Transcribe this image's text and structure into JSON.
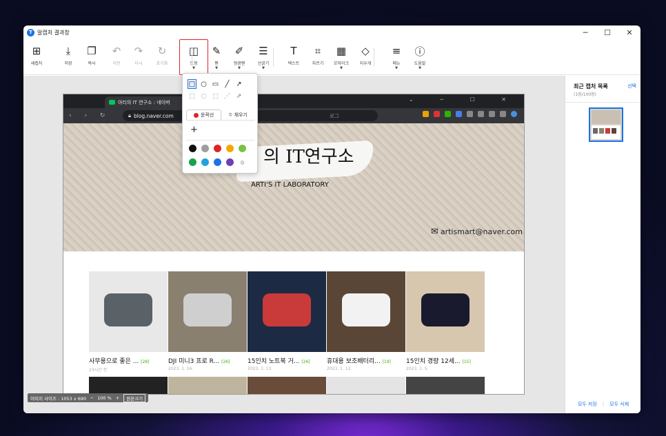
{
  "window": {
    "title": "알캡처 결과창",
    "logo": "T",
    "controls": [
      "─",
      "☐",
      "✕"
    ]
  },
  "toolbar": {
    "items": [
      {
        "key": "new",
        "label": "새캡처",
        "icon": "new-capture-icon",
        "glyph": "⊞"
      },
      {
        "key": "save",
        "label": "저장",
        "icon": "download-icon",
        "glyph": "⤓"
      },
      {
        "key": "copy",
        "label": "복사",
        "icon": "copy-icon",
        "glyph": "❐"
      },
      {
        "key": "undo",
        "label": "이전",
        "icon": "undo-icon",
        "glyph": "↶",
        "disabled": true
      },
      {
        "key": "redo",
        "label": "다시",
        "icon": "redo-icon",
        "glyph": "↷",
        "disabled": true
      },
      {
        "key": "reset",
        "label": "초기화",
        "icon": "reset-icon",
        "glyph": "↻",
        "disabled": true
      },
      {
        "key": "shape",
        "label": "도형",
        "icon": "shape-icon",
        "glyph": "◫",
        "caret": true
      },
      {
        "key": "pen",
        "label": "펜",
        "icon": "pen-icon",
        "glyph": "✎",
        "caret": true
      },
      {
        "key": "highlighter",
        "label": "형광펜",
        "icon": "highlighter-icon",
        "glyph": "✐",
        "caret": true
      },
      {
        "key": "thickness",
        "label": "선굵기",
        "icon": "line-width-icon",
        "glyph": "☰",
        "caret": true
      },
      {
        "key": "text",
        "label": "텍스트",
        "icon": "text-icon",
        "glyph": "T"
      },
      {
        "key": "crop",
        "label": "자르기",
        "icon": "crop-icon",
        "glyph": "⌗"
      },
      {
        "key": "mosaic",
        "label": "모자이크",
        "icon": "mosaic-icon",
        "glyph": "▦",
        "caret": true
      },
      {
        "key": "eraser",
        "label": "지우개",
        "icon": "eraser-icon",
        "glyph": "◇"
      },
      {
        "key": "menu",
        "label": "메뉴",
        "icon": "menu-icon",
        "glyph": "≡",
        "caret": true
      },
      {
        "key": "help",
        "label": "도움말",
        "icon": "help-icon",
        "glyph": "ⓘ",
        "caret": true
      }
    ]
  },
  "shape_popup": {
    "row1": [
      "□",
      "○",
      "▭",
      "╱",
      "↗"
    ],
    "row2": [
      "⬚",
      "◌",
      "⬚",
      "⋰",
      "⇗"
    ],
    "outline_tab": "윤곽선",
    "fill_tab": "채우기",
    "add": "+",
    "colors_row1": [
      "#111111",
      "#9e9e9e",
      "#e02424",
      "#f5a700",
      "#7cc242"
    ],
    "colors_row2": [
      "#17a34a",
      "#1fa3e0",
      "#1a73e8",
      "#6f3fb5"
    ],
    "no_color_glyph": "⦸"
  },
  "right_panel": {
    "title": "최근 캡처 목록",
    "count": "(1장/100장)",
    "select": "선택",
    "save_all": "모두 저장",
    "delete_all": "모두 삭제",
    "divider": "|"
  },
  "status": {
    "size_label": "이미지 사이즈 : 1053 x 690",
    "zoom_minus": "─",
    "zoom_value": "100 %",
    "zoom_plus": "+",
    "zoom_reset": "원본크기"
  },
  "captured": {
    "tab_title": "아티의 IT 연구소 : 네이버",
    "window_ctrls": "⌄ ─ ☐ ✕",
    "nav": "‹ › ↻",
    "url": "blog.naver.com",
    "url_tail": "로그",
    "banner_title": "의 IT연구소",
    "banner_sub": "ARTI'S IT LABORATORY",
    "mail_glyph": "✉",
    "email": "artismart@naver.com",
    "posts": [
      {
        "title": "사무용으로 좋은 ...",
        "count": "[28]",
        "date": "23시간 전",
        "bg": "#e8e8e8",
        "obj": "#5a6268"
      },
      {
        "title": "DJI 미니3 프로 R...",
        "count": "[26]",
        "date": "2023. 1. 16.",
        "bg": "#8a8070",
        "obj": "#cfcfcf"
      },
      {
        "title": "15인치 노트북 거...",
        "count": "[26]",
        "date": "2023. 1. 13.",
        "bg": "#1c2a44",
        "obj": "#c93a3a"
      },
      {
        "title": "휴대용 보조배터리...",
        "count": "[19]",
        "date": "2023. 1. 12.",
        "bg": "#5a4636",
        "obj": "#f2f2f2"
      },
      {
        "title": "15인치 경량 12세...",
        "count": "[15]",
        "date": "2023. 1. 5.",
        "bg": "#d6c7ae",
        "obj": "#1a1a2e"
      }
    ],
    "row2_colors": [
      "#222222",
      "#bfb59e",
      "#6a4c3a",
      "#e4e4e4",
      "#444444"
    ]
  }
}
